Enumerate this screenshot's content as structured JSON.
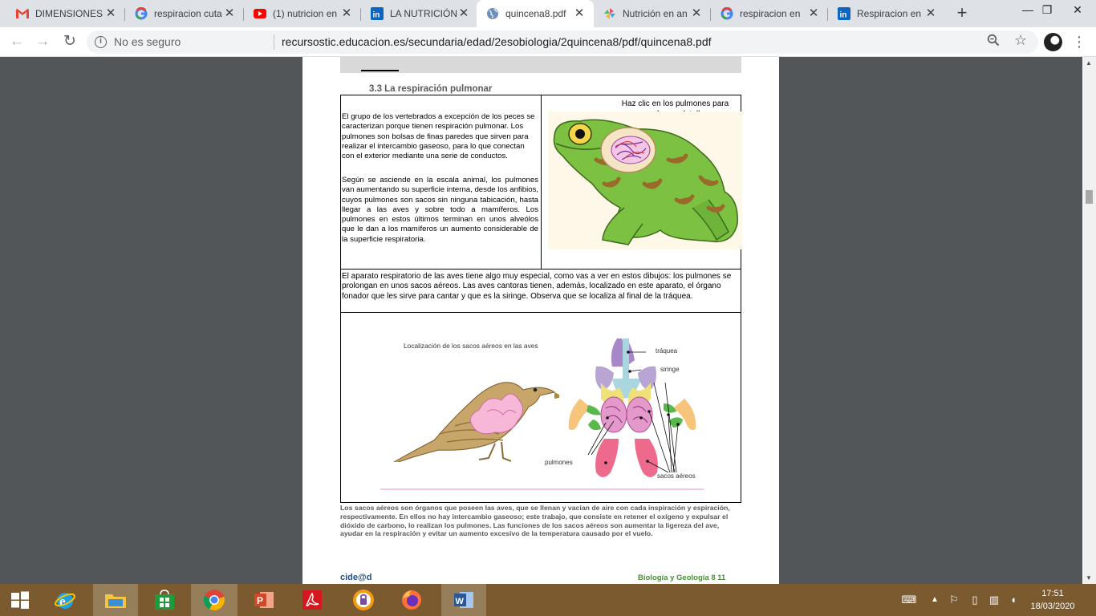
{
  "browser": {
    "tabs": [
      {
        "title": "DIMENSIONES",
        "icon": "gmail-icon",
        "active": false
      },
      {
        "title": "respiracion cuta",
        "icon": "google-icon",
        "active": false
      },
      {
        "title": "(1) nutricion en",
        "icon": "youtube-icon",
        "active": false
      },
      {
        "title": "LA NUTRICIÓN",
        "icon": "linkedin-icon",
        "active": false
      },
      {
        "title": "quincena8.pdf",
        "icon": "globe-icon",
        "active": true
      },
      {
        "title": "Nutrición en an",
        "icon": "pinwheel-icon",
        "active": false
      },
      {
        "title": "respiracion en",
        "icon": "google-icon",
        "active": false
      },
      {
        "title": "Respiracion en",
        "icon": "linkedin-icon",
        "active": false
      }
    ],
    "new_tab": "+",
    "window_controls": {
      "minimize": "—",
      "restore": "❐",
      "close": "✕"
    },
    "security_label": "No es seguro",
    "url": "recursostic.educacion.es/secundaria/edad/2esobiologia/2quincena8/pdf/quincena8.pdf"
  },
  "pdf": {
    "section_title": "3.3   La respiración pulmonar",
    "paragraph_1": "El grupo de los vertebrados a excepción de los peces se caracterizan porque tienen respiración pulmonar. Los pulmones son bolsas de finas paredes que sirven para realizar el intercambio gaseoso, para lo que conectan con el exterior mediante una serie de conductos.",
    "paragraph_2": "Según se asciende en la escala animal, los pulmones van aumentando su superficie interna, desde los anfibios, cuyos pulmones son sacos sin ninguna tabicación, hasta llegar a las aves y sobre todo a mamíferos. Los pulmones en estos últimos terminan en unos alveólos que le dan a los mamíferos un aumento considerable de la superficie respiratoria.",
    "frog_caption": "Haz clic en los pulmones para verlos en detalle",
    "paragraph_3": "El aparato respiratorio de las aves tiene algo muy especial, como vas a ver en estos dibujos: los pulmones se prolongan en unos sacos aéreos. Las aves cantoras tienen, además, localizado en este aparato, el órgano fonador que les sirve para cantar y que es la siringe. Observa que se localiza al final de la tráquea.",
    "bird_figure_title": "Localización de los sacos aéreos en las aves",
    "labels": {
      "trachea": "tráquea",
      "syrinx": "siringe",
      "lungs": "pulmones",
      "air_sacs": "sacos aéreos"
    },
    "paragraph_4": "Los sacos aéreos son órganos que poseen las aves, que se llenan y vacían de aire con cada inspiración y espiración, respectivamente. En ellos no hay intercambio gaseoso; este trabajo, que consiste en retener el oxígeno  y expulsar el dióxido de carbono, lo realizan los pulmones. Las funciones de los sacos aéreos son aumentar la ligereza del ave, ayudar en la respiración  y evitar un aumento excesivo de la temperatura causado por el vuelo.",
    "footer_logo": "cide@d",
    "footer_right": "Biología y Geología 8  11"
  },
  "taskbar": {
    "apps": [
      "windows-start-icon",
      "internet-explorer-icon",
      "file-explorer-icon",
      "store-icon",
      "chrome-icon",
      "powerpoint-icon",
      "acrobat-icon",
      "vpn-shield-icon",
      "firefox-icon",
      "word-icon"
    ],
    "time": "17:51",
    "date": "18/03/2020"
  },
  "colors": {
    "pdf_background": "#525659",
    "taskbar": "#7a5a2e",
    "tabstrip": "#dee1e6",
    "footer_green": "#4a8c3a",
    "footer_blue": "#1f4e8c"
  }
}
